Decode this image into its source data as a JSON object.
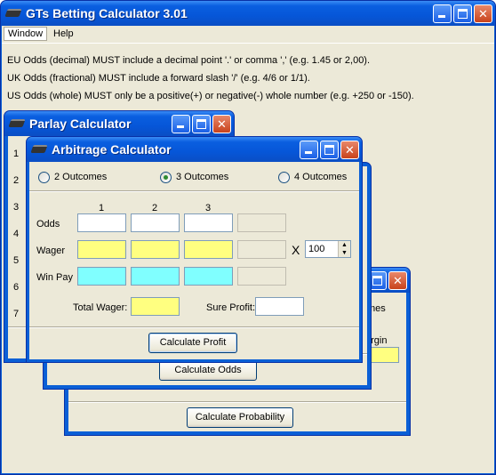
{
  "main": {
    "title": "GTs Betting Calculator  3.01",
    "menu": [
      "Window",
      "Help"
    ],
    "hints": [
      "EU Odds (decimal) MUST include a decimal point '.' or comma ',' (e.g. 1.45 or 2,00).",
      "UK Odds (fractional) MUST include a forward slash '/' (e.g. 4/6 or 1/1).",
      "US Odds (whole) MUST only be a positive(+) or negative(-) whole number (e.g. +250 or -150)."
    ]
  },
  "probability_window": {
    "partial_label_mes": "mes",
    "partial_label_argin": "argin",
    "calc_button": "Calculate Probability"
  },
  "odds_window": {
    "calc_button": "Calculate Odds"
  },
  "parlay": {
    "title": "Parlay Calculator",
    "row_numbers": [
      "1",
      "2",
      "3",
      "4",
      "5",
      "6",
      "7"
    ]
  },
  "arbitrage": {
    "title": "Arbitrage Calculator",
    "outcome_options": [
      "2 Outcomes",
      "3 Outcomes",
      "4 Outcomes"
    ],
    "selected_outcome_index": 1,
    "column_headers": [
      "1",
      "2",
      "3"
    ],
    "row_labels": {
      "odds": "Odds",
      "wager": "Wager",
      "win_pay": "Win Pay"
    },
    "multiplier_symbol": "X",
    "multiplier_value": "100",
    "total_wager_label": "Total Wager:",
    "sure_profit_label": "Sure Profit:",
    "calc_button": "Calculate Profit"
  },
  "colors": {
    "titlebar": "#0a5fe0",
    "wager_field": "#ffff80",
    "winpay_field": "#80ffff",
    "face": "#ece9d8"
  },
  "icons": [
    "window-app-icon",
    "minimize-icon",
    "maximize-icon",
    "close-icon",
    "spin-up-icon",
    "spin-down-icon"
  ]
}
